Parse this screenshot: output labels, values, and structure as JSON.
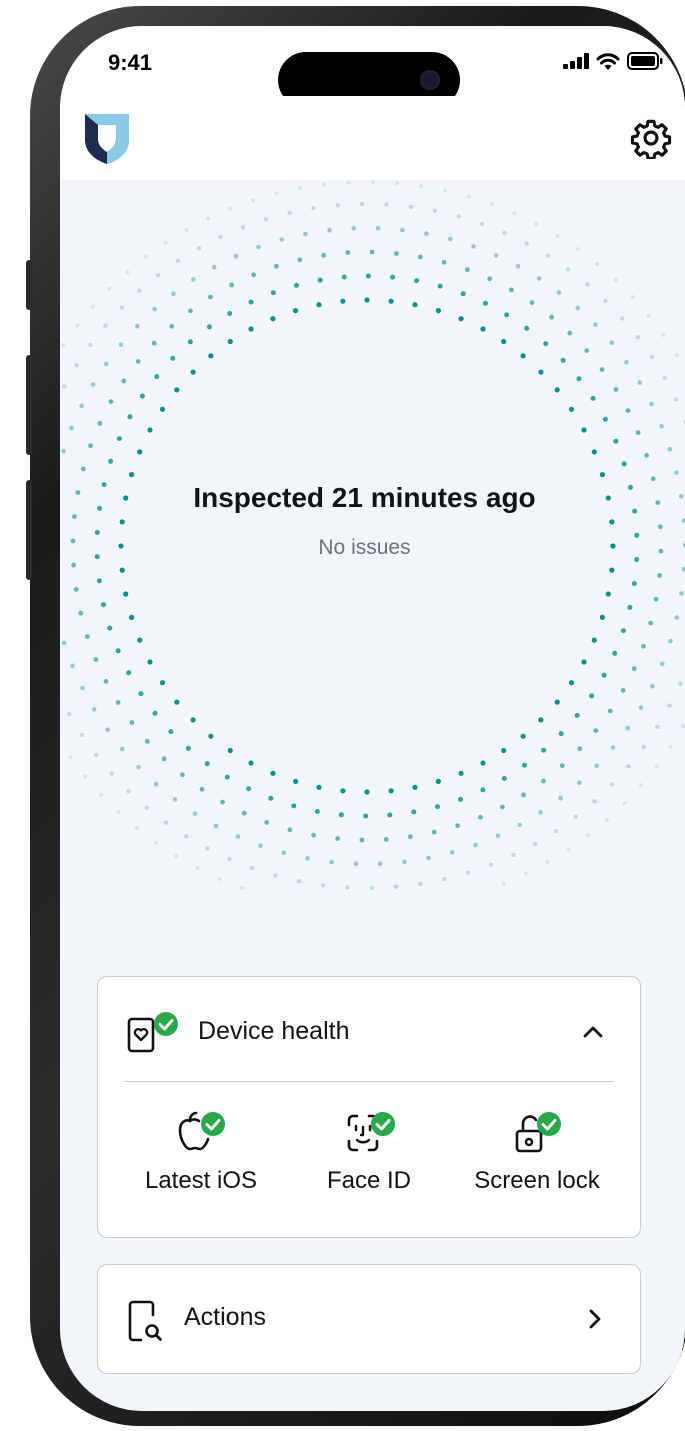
{
  "status_bar": {
    "time": "9:41"
  },
  "header": {
    "logo_icon": "shield-logo-icon",
    "settings_icon": "gear-icon"
  },
  "inspection": {
    "title": "Inspected 21 minutes ago",
    "subtitle": "No issues"
  },
  "device_health": {
    "title": "Device health",
    "expanded": true,
    "items": [
      {
        "label": "Latest iOS",
        "icon": "apple-icon",
        "status": "ok"
      },
      {
        "label": "Face ID",
        "icon": "face-id-icon",
        "status": "ok"
      },
      {
        "label": "Screen lock",
        "icon": "unlock-icon",
        "status": "ok"
      }
    ]
  },
  "actions": {
    "title": "Actions"
  },
  "colors": {
    "accent": "#0b8f8c",
    "success": "#27a84a",
    "brand_dark": "#1f2b4f",
    "brand_light": "#8fd3f0"
  }
}
